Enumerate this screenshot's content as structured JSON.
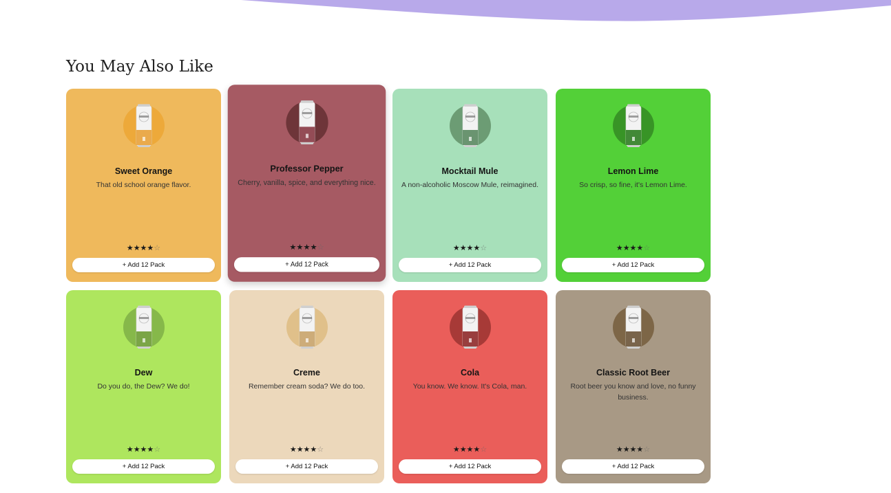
{
  "section": {
    "title": "You May Also Like"
  },
  "colors": {
    "wave": "#b8a9ea"
  },
  "products": [
    {
      "name": "Sweet Orange",
      "description": "That old school orange flavor.",
      "bg": "#efb95c",
      "circle": "#eda93a",
      "accent": "#e9a23a",
      "rating": 4,
      "button": "+ Add 12 Pack",
      "stars_text": "★★★★",
      "empty_text": "☆"
    },
    {
      "name": "Professor Pepper",
      "description": "Cherry, vanilla, spice, and everything nice.",
      "bg": "#a65a63",
      "circle": "#6e3539",
      "accent": "#8a3a45",
      "rating": 4,
      "button": "+ Add 12 Pack",
      "stars_text": "★★★★",
      "empty_text": "☆"
    },
    {
      "name": "Mocktail Mule",
      "description": "A non-alcoholic Moscow Mule, reimagined.",
      "bg": "#a7e0ba",
      "circle": "#6c9c74",
      "accent": "#5b8a62",
      "rating": 4,
      "button": "+ Add 12 Pack",
      "stars_text": "★★★★",
      "empty_text": "☆"
    },
    {
      "name": "Lemon Lime",
      "description": "So crisp, so fine, it's Lemon Lime.",
      "bg": "#53d038",
      "circle": "#389426",
      "accent": "#2f7d22",
      "rating": 4,
      "button": "+ Add 12 Pack",
      "stars_text": "★★★★",
      "empty_text": "☆"
    },
    {
      "name": "Dew",
      "description": "Do you do, the Dew? We do!",
      "bg": "#aee65e",
      "circle": "#86b84a",
      "accent": "#6e9c34",
      "rating": 4,
      "button": "+ Add 12 Pack",
      "stars_text": "★★★★",
      "empty_text": "☆"
    },
    {
      "name": "Creme",
      "description": "Remember cream soda? We do too.",
      "bg": "#ecd8bb",
      "circle": "#e0c08a",
      "accent": "#c9a46b",
      "rating": 4,
      "button": "+ Add 12 Pack",
      "stars_text": "★★★★",
      "empty_text": "☆"
    },
    {
      "name": "Cola",
      "description": "You know. We know. It's Cola, man.",
      "bg": "#ea5e5a",
      "circle": "#a73a37",
      "accent": "#8f2a2a",
      "rating": 4,
      "button": "+ Add 12 Pack",
      "stars_text": "★★★★",
      "empty_text": "☆"
    },
    {
      "name": "Classic Root Beer",
      "description": "Root beer you know and love, no funny business.",
      "bg": "#a89985",
      "circle": "#7d6647",
      "accent": "#6b5438",
      "rating": 4,
      "button": "+ Add 12 Pack",
      "stars_text": "★★★★",
      "empty_text": "☆"
    }
  ],
  "hovered_index": 1
}
